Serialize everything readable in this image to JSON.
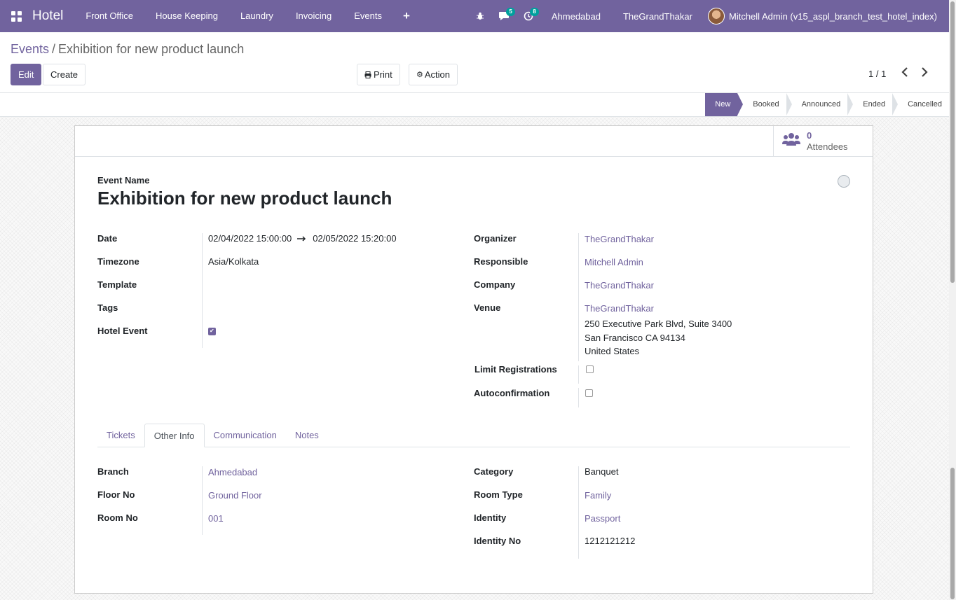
{
  "navbar": {
    "brand": "Hotel",
    "menus": [
      "Front Office",
      "House Keeping",
      "Laundry",
      "Invoicing",
      "Events"
    ],
    "messages_badge": "5",
    "activities_badge": "8",
    "branch": "Ahmedabad",
    "company": "TheGrandThakar",
    "user": "Mitchell Admin (v15_aspl_branch_test_hotel_index)"
  },
  "breadcrumb": {
    "parent": "Events",
    "current": "Exhibition for new product launch"
  },
  "buttons": {
    "edit": "Edit",
    "create": "Create",
    "print": "Print",
    "action": "Action"
  },
  "pager": {
    "value": "1 / 1"
  },
  "stages": [
    "New",
    "Booked",
    "Announced",
    "Ended",
    "Cancelled"
  ],
  "active_stage": "New",
  "stat": {
    "value": "0",
    "label": "Attendees"
  },
  "form": {
    "title_label": "Event Name",
    "title": "Exhibition for new product launch",
    "left": {
      "date_label": "Date",
      "date_start": "02/04/2022 15:00:00",
      "date_end": "02/05/2022 15:20:00",
      "timezone_label": "Timezone",
      "timezone": "Asia/Kolkata",
      "template_label": "Template",
      "tags_label": "Tags",
      "hotel_event_label": "Hotel Event"
    },
    "right": {
      "organizer_label": "Organizer",
      "organizer": "TheGrandThakar",
      "responsible_label": "Responsible",
      "responsible": "Mitchell Admin",
      "company_label": "Company",
      "company": "TheGrandThakar",
      "venue_label": "Venue",
      "venue": "TheGrandThakar",
      "venue_addr1": "250 Executive Park Blvd, Suite 3400",
      "venue_addr2": "San Francisco CA 94134",
      "venue_addr3": "United States",
      "limit_label": "Limit Registrations",
      "autoconf_label": "Autoconfirmation"
    },
    "tabs": [
      "Tickets",
      "Other Info",
      "Communication",
      "Notes"
    ],
    "active_tab": "Other Info",
    "other_info": {
      "branch_label": "Branch",
      "branch": "Ahmedabad",
      "floor_label": "Floor No",
      "floor": "Ground Floor",
      "room_label": "Room No",
      "room": "001",
      "category_label": "Category",
      "category": "Banquet",
      "room_type_label": "Room Type",
      "room_type": "Family",
      "identity_label": "Identity",
      "identity": "Passport",
      "identity_no_label": "Identity No",
      "identity_no": "1212121212"
    }
  },
  "colors": {
    "primary": "#71639e",
    "badge": "#00a09d"
  }
}
